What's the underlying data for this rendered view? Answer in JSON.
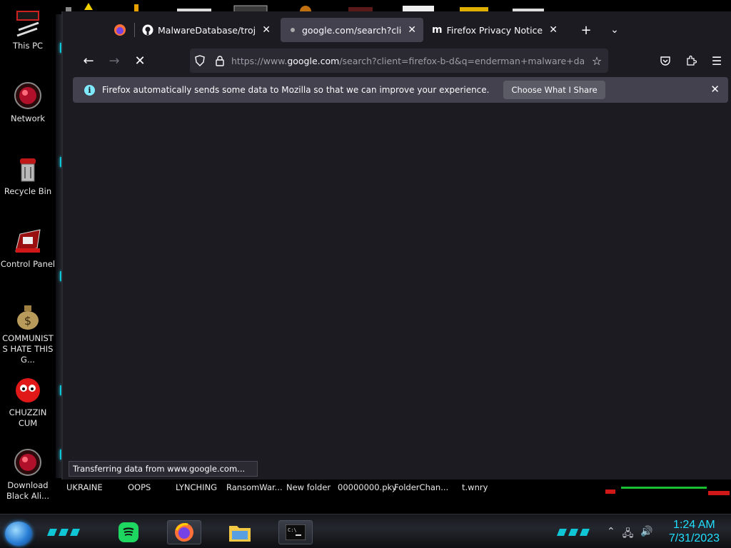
{
  "desktop": {
    "icons": [
      {
        "label": "This PC",
        "icon": "computer-icon"
      },
      {
        "label": "Network",
        "icon": "network-orb-icon"
      },
      {
        "label": "Recycle Bin",
        "icon": "recycle-bin-icon"
      },
      {
        "label": "Control Panel",
        "icon": "control-panel-icon"
      },
      {
        "label": "COMMUNISTS HATE THIS G...",
        "icon": "money-bag-icon"
      },
      {
        "label": "CHUZZIN CUM",
        "icon": "red-creature-icon"
      },
      {
        "label": "Download Black Ali...",
        "icon": "download-orb-icon"
      }
    ],
    "bottom_row": [
      "UKRAINE",
      "OOPS",
      "LYNCHING",
      "RansomWar...",
      "New folder",
      "00000000.pky",
      "FolderChan...",
      "t.wnry"
    ]
  },
  "browser": {
    "tabs": [
      {
        "title": "MalwareDatabase/trojans/W",
        "icon": "github-icon",
        "active": false
      },
      {
        "title": "google.com/search?client=",
        "icon": "loading-dot-icon",
        "active": true
      },
      {
        "title": "Firefox Privacy Notice — Mo",
        "icon": "mozilla-m-icon",
        "active": false
      }
    ],
    "url": {
      "prefix": "https://www.",
      "host": "google.com",
      "rest": "/search?client=firefox-b-d&q=enderman+malware+daab"
    },
    "notification": {
      "message": "Firefox automatically sends some data to Mozilla so that we can improve your experience.",
      "button": "Choose What I Share"
    },
    "status": "Transferring data from www.google.com..."
  },
  "taskbar": {
    "time": "1:24 AM",
    "date": "7/31/2023"
  },
  "colors": {
    "accent_cyan": "#21e0ff",
    "firefox_dark": "#1c1b22",
    "tab_active": "#42414d"
  }
}
